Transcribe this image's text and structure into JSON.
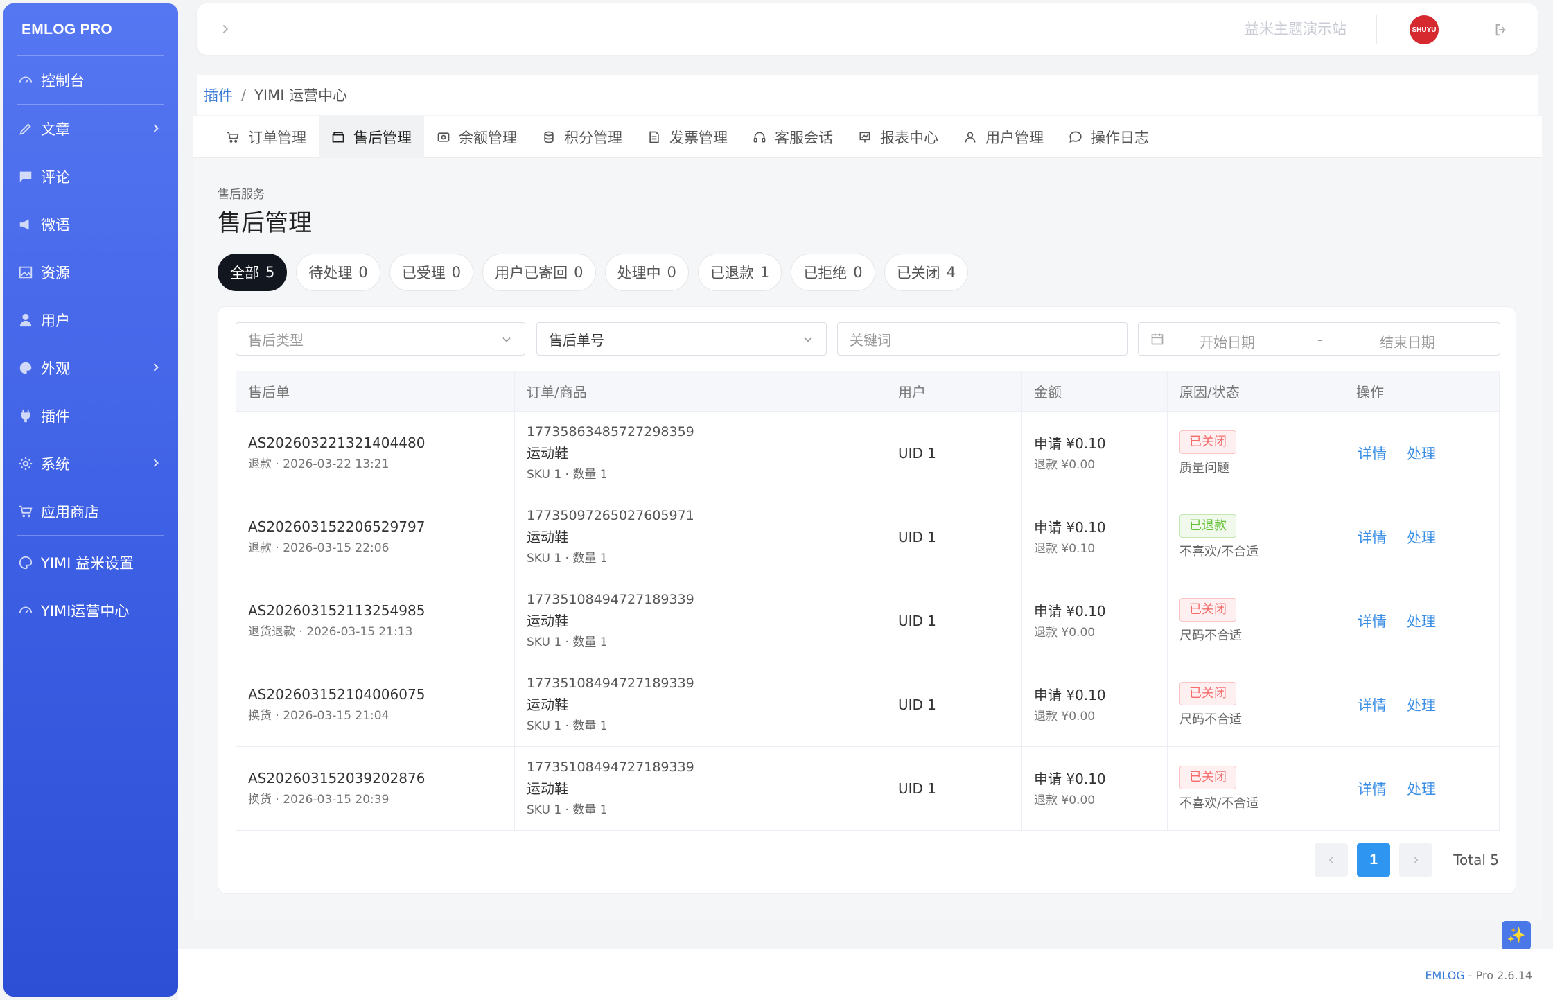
{
  "sidebar": {
    "brand": "EMLOG PRO",
    "items": [
      {
        "label": "控制台",
        "icon": "dashboard-icon"
      },
      {
        "label": "文章",
        "icon": "pencil-icon",
        "has_children": true
      },
      {
        "label": "评论",
        "icon": "comment-icon"
      },
      {
        "label": "微语",
        "icon": "megaphone-icon"
      },
      {
        "label": "资源",
        "icon": "image-icon"
      },
      {
        "label": "用户",
        "icon": "user-icon"
      },
      {
        "label": "外观",
        "icon": "palette-icon",
        "has_children": true
      },
      {
        "label": "插件",
        "icon": "plug-icon"
      },
      {
        "label": "系统",
        "icon": "gear-icon",
        "has_children": true
      },
      {
        "label": "应用商店",
        "icon": "cart-icon"
      }
    ],
    "plugin_items": [
      {
        "label": "YIMI 益米设置",
        "icon": "palette-icon"
      },
      {
        "label": "YIMI运营中心",
        "icon": "dashboard-icon"
      }
    ]
  },
  "topbar": {
    "site_name": "益米主题演示站",
    "avatar_text": "SHUYU"
  },
  "breadcrumb": {
    "parent": "插件",
    "separator": "/",
    "current": "YIMI 运营中心"
  },
  "tabs": [
    {
      "label": "订单管理",
      "icon": "cart-icon"
    },
    {
      "label": "售后管理",
      "icon": "box-icon",
      "active": true
    },
    {
      "label": "余额管理",
      "icon": "wallet-icon"
    },
    {
      "label": "积分管理",
      "icon": "coins-icon"
    },
    {
      "label": "发票管理",
      "icon": "invoice-icon"
    },
    {
      "label": "客服会话",
      "icon": "headset-icon"
    },
    {
      "label": "报表中心",
      "icon": "chart-icon"
    },
    {
      "label": "用户管理",
      "icon": "user-icon"
    },
    {
      "label": "操作日志",
      "icon": "chat-icon"
    }
  ],
  "page": {
    "subtitle": "售后服务",
    "title": "售后管理"
  },
  "status_filters": [
    {
      "label": "全部",
      "count": "5",
      "active": true
    },
    {
      "label": "待处理",
      "count": "0"
    },
    {
      "label": "已受理",
      "count": "0"
    },
    {
      "label": "用户已寄回",
      "count": "0"
    },
    {
      "label": "处理中",
      "count": "0"
    },
    {
      "label": "已退款",
      "count": "1"
    },
    {
      "label": "已拒绝",
      "count": "0"
    },
    {
      "label": "已关闭",
      "count": "4"
    }
  ],
  "filters": {
    "type_placeholder": "售后类型",
    "search_field_value": "售后单号",
    "keyword_placeholder": "关键词",
    "start_date_placeholder": "开始日期",
    "date_separator": "-",
    "end_date_placeholder": "结束日期"
  },
  "table": {
    "headers": [
      "售后单",
      "订单/商品",
      "用户",
      "金额",
      "原因/状态",
      "操作"
    ],
    "rows": [
      {
        "as_no": "AS202603221321404480",
        "type_time": "退款 · 2026-03-22 13:21",
        "order_no": "17735863485727298359",
        "product": "运动鞋",
        "sku": "SKU 1 · 数量 1",
        "user": "UID 1",
        "apply": "申请 ¥0.10",
        "refund": "退款 ¥0.00",
        "status": "已关闭",
        "status_kind": "closed",
        "reason": "质量问题",
        "detail": "详情",
        "handle": "处理"
      },
      {
        "as_no": "AS202603152206529797",
        "type_time": "退款 · 2026-03-15 22:06",
        "order_no": "17735097265027605971",
        "product": "运动鞋",
        "sku": "SKU 1 · 数量 1",
        "user": "UID 1",
        "apply": "申请 ¥0.10",
        "refund": "退款 ¥0.10",
        "status": "已退款",
        "status_kind": "refunded",
        "reason": "不喜欢/不合适",
        "detail": "详情",
        "handle": "处理"
      },
      {
        "as_no": "AS202603152113254985",
        "type_time": "退货退款 · 2026-03-15 21:13",
        "order_no": "17735108494727189339",
        "product": "运动鞋",
        "sku": "SKU 1 · 数量 1",
        "user": "UID 1",
        "apply": "申请 ¥0.10",
        "refund": "退款 ¥0.00",
        "status": "已关闭",
        "status_kind": "closed",
        "reason": "尺码不合适",
        "detail": "详情",
        "handle": "处理"
      },
      {
        "as_no": "AS202603152104006075",
        "type_time": "换货 · 2026-03-15 21:04",
        "order_no": "17735108494727189339",
        "product": "运动鞋",
        "sku": "SKU 1 · 数量 1",
        "user": "UID 1",
        "apply": "申请 ¥0.10",
        "refund": "退款 ¥0.00",
        "status": "已关闭",
        "status_kind": "closed",
        "reason": "尺码不合适",
        "detail": "详情",
        "handle": "处理"
      },
      {
        "as_no": "AS202603152039202876",
        "type_time": "换货 · 2026-03-15 20:39",
        "order_no": "17735108494727189339",
        "product": "运动鞋",
        "sku": "SKU 1 · 数量 1",
        "user": "UID 1",
        "apply": "申请 ¥0.10",
        "refund": "退款 ¥0.00",
        "status": "已关闭",
        "status_kind": "closed",
        "reason": "不喜欢/不合适",
        "detail": "详情",
        "handle": "处理"
      }
    ]
  },
  "pagination": {
    "current_page": "1",
    "total": "Total 5"
  },
  "footer": {
    "brand": "EMLOG",
    "version": " - Pro 2.6.14"
  },
  "fab_icon": "sparkle-icon",
  "colors": {
    "sidebar_top": "#5677f2",
    "sidebar_bottom": "#2d4fd6",
    "link": "#3a8ee6",
    "chip_active": "#12161f",
    "status_closed": "#f56c6c",
    "status_refunded": "#67c23a",
    "page_current": "#2e96f0"
  }
}
